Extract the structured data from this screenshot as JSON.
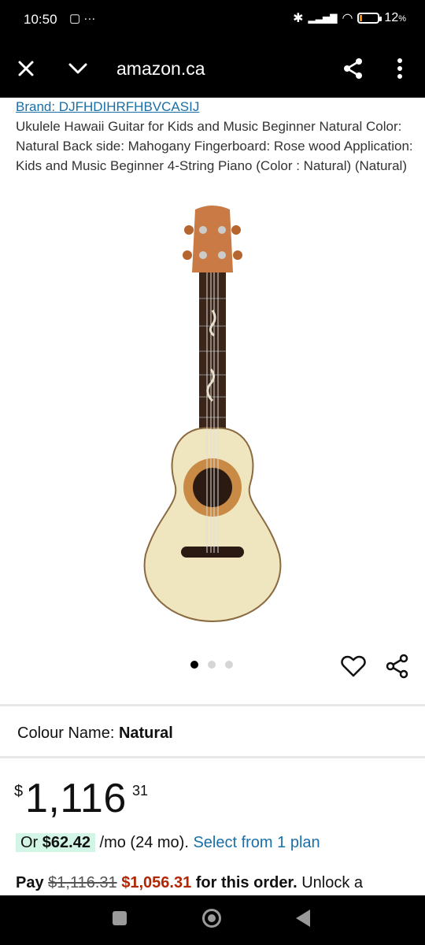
{
  "status": {
    "time": "10:50",
    "battery": "12",
    "battery_unit": "%"
  },
  "browser": {
    "title": "amazon.ca"
  },
  "product": {
    "brand": "Brand: DJFHDIHRFHBVCASIJ",
    "title": "Ukulele Hawaii Guitar for Kids and Music Beginner Natural Color: Natural Back side: Mahogany Fingerboard: Rose wood Application: Kids and Music Beginner 4-String Piano (Color : Natural) (Natural)",
    "colour_label": "Colour Name:",
    "colour_value": "Natural",
    "price": {
      "currency": "$",
      "whole": "1,116",
      "fraction": "31"
    },
    "monthly": {
      "prefix": "Or",
      "amount": "$62.42",
      "term": "/mo (24 mo).",
      "link": "Select from 1 plan"
    },
    "pay": {
      "label": "Pay",
      "original": "$1,116.31",
      "discounted": "$1,056.31",
      "suffix": "for this order.",
      "tail": "Unlock a"
    },
    "carousel": {
      "count": 3,
      "active": 1
    }
  },
  "colors": {
    "link": "#1a6fa8",
    "deal_red": "#b12704",
    "pill_bg": "#d3f5e6"
  }
}
